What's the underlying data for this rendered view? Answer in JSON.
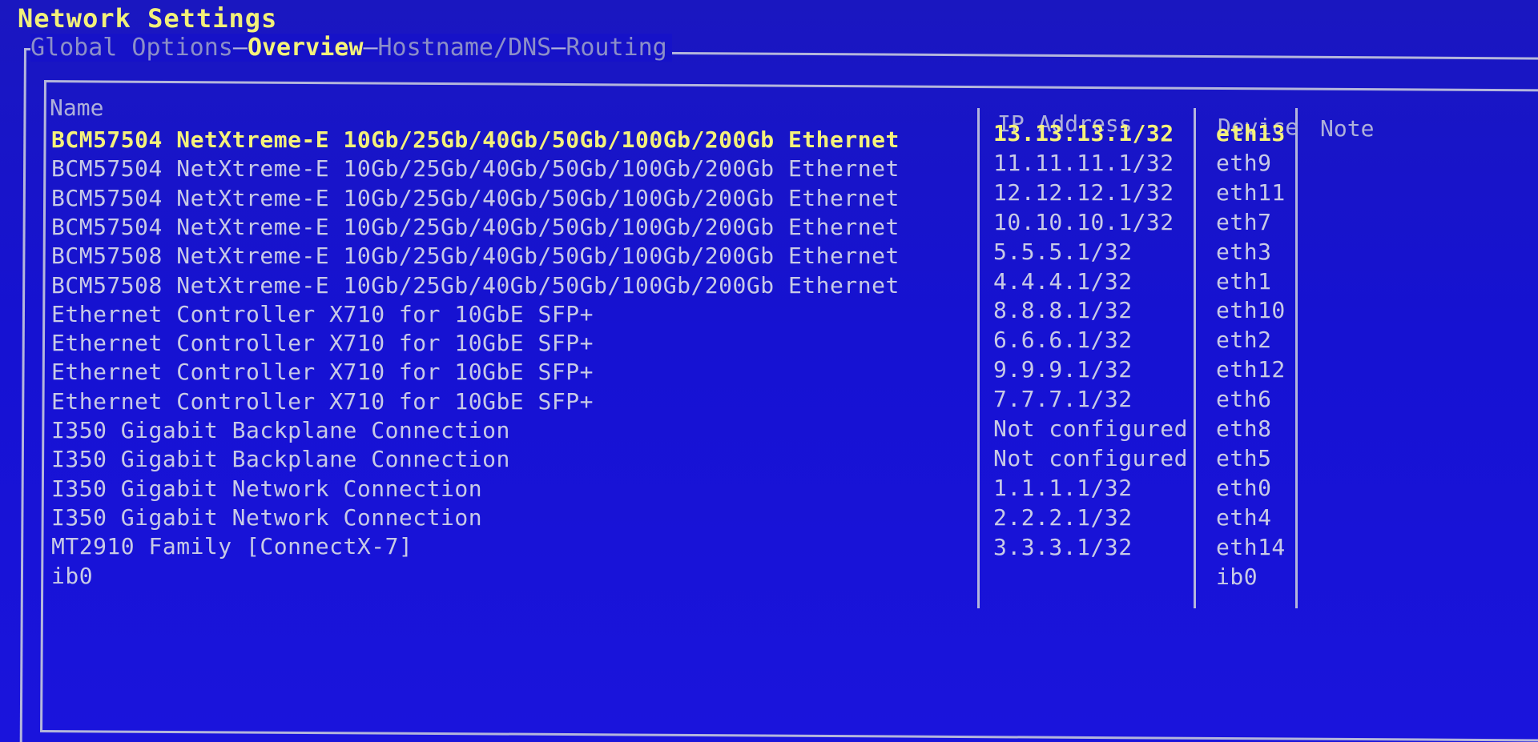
{
  "title": "Network Settings",
  "tabs": [
    {
      "label": "Global Options",
      "active": false
    },
    {
      "label": "Overview",
      "active": true
    },
    {
      "label": "Hostname/DNS",
      "active": false
    },
    {
      "label": "Routing",
      "active": false
    }
  ],
  "columns": {
    "name": "Name",
    "ip": "IP Address",
    "device": "Device",
    "note": "Note"
  },
  "rows": [
    {
      "name": "BCM57504 NetXtreme-E 10Gb/25Gb/40Gb/50Gb/100Gb/200Gb Ethernet",
      "ip": "13.13.13.1/32",
      "device": "eth13",
      "note": "",
      "selected": true
    },
    {
      "name": "BCM57504 NetXtreme-E 10Gb/25Gb/40Gb/50Gb/100Gb/200Gb Ethernet",
      "ip": "11.11.11.1/32",
      "device": "eth9",
      "note": ""
    },
    {
      "name": "BCM57504 NetXtreme-E 10Gb/25Gb/40Gb/50Gb/100Gb/200Gb Ethernet",
      "ip": "12.12.12.1/32",
      "device": "eth11",
      "note": ""
    },
    {
      "name": "BCM57504 NetXtreme-E 10Gb/25Gb/40Gb/50Gb/100Gb/200Gb Ethernet",
      "ip": "10.10.10.1/32",
      "device": "eth7",
      "note": ""
    },
    {
      "name": "BCM57508 NetXtreme-E 10Gb/25Gb/40Gb/50Gb/100Gb/200Gb Ethernet",
      "ip": "5.5.5.1/32",
      "device": "eth3",
      "note": ""
    },
    {
      "name": "BCM57508 NetXtreme-E 10Gb/25Gb/40Gb/50Gb/100Gb/200Gb Ethernet",
      "ip": "4.4.4.1/32",
      "device": "eth1",
      "note": ""
    },
    {
      "name": "Ethernet Controller X710 for 10GbE SFP+",
      "ip": "8.8.8.1/32",
      "device": "eth10",
      "note": ""
    },
    {
      "name": "Ethernet Controller X710 for 10GbE SFP+",
      "ip": "6.6.6.1/32",
      "device": "eth2",
      "note": ""
    },
    {
      "name": "Ethernet Controller X710 for 10GbE SFP+",
      "ip": "9.9.9.1/32",
      "device": "eth12",
      "note": ""
    },
    {
      "name": "Ethernet Controller X710 for 10GbE SFP+",
      "ip": "7.7.7.1/32",
      "device": "eth6",
      "note": ""
    },
    {
      "name": "I350 Gigabit Backplane Connection",
      "ip": "Not configured",
      "device": "eth8",
      "note": ""
    },
    {
      "name": "I350 Gigabit Backplane Connection",
      "ip": "Not configured",
      "device": "eth5",
      "note": ""
    },
    {
      "name": "I350 Gigabit Network Connection",
      "ip": "1.1.1.1/32",
      "device": "eth0",
      "note": ""
    },
    {
      "name": "I350 Gigabit Network Connection",
      "ip": "2.2.2.1/32",
      "device": "eth4",
      "note": ""
    },
    {
      "name": "MT2910 Family [ConnectX-7]",
      "ip": "3.3.3.1/32",
      "device": "eth14",
      "note": ""
    },
    {
      "name": "ib0",
      "ip": "",
      "device": "ib0",
      "note": ""
    }
  ]
}
